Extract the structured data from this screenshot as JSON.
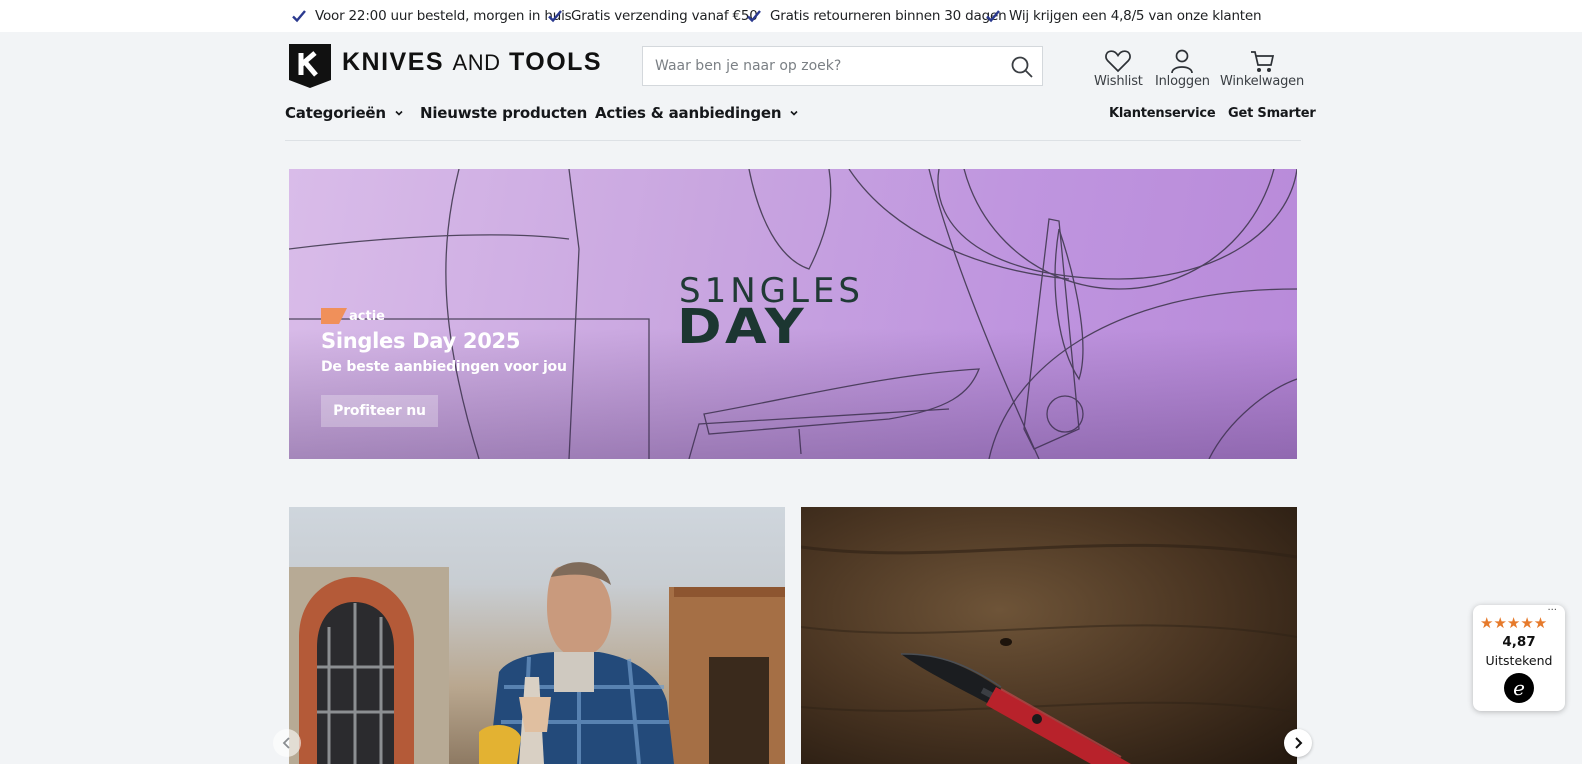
{
  "usp_bar": {
    "items": [
      "Voor 22:00 uur besteld, morgen in huis",
      "Gratis verzending vanaf €50",
      "Gratis retourneren binnen 30 dagen",
      "Wij krijgen een 4,8/5 van onze klanten"
    ]
  },
  "header": {
    "logo_main": "KNIVES",
    "logo_and": "AND",
    "logo_end": "TOOLS",
    "search_placeholder": "Waar ben je naar op zoek?",
    "actions": {
      "wishlist": "Wishlist",
      "login": "Inloggen",
      "cart": "Winkelwagen"
    }
  },
  "nav": {
    "categories": "Categorieën",
    "new_products": "Nieuwste producten",
    "deals": "Acties & aanbiedingen",
    "customer_service": "Klantenservice",
    "get_smarter": "Get Smarter"
  },
  "hero": {
    "art_singles": "S1NGLES",
    "art_day": "DAY",
    "badge": "actie",
    "title": "Singles Day 2025",
    "subtitle": "De beste aanbiedingen voor jou",
    "cta": "Profiteer nu"
  },
  "trust_widget": {
    "stars": "★★★★★",
    "score": "4,87",
    "label": "Uitstekend",
    "menu": "···",
    "logo_letter": "e"
  },
  "colors": {
    "accent_check": "#2b3a8f",
    "hero_purple": "#c9a6e0",
    "badge_orange": "#f0905a",
    "star_orange": "#e67a2b"
  }
}
